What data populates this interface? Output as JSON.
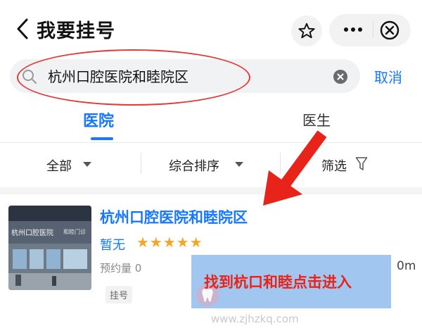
{
  "header": {
    "title": "我要挂号"
  },
  "search": {
    "query": "杭州口腔医院和睦院区",
    "cancel_label": "取消"
  },
  "tabs": [
    {
      "label": "医院",
      "active": true
    },
    {
      "label": "医生",
      "active": false
    }
  ],
  "filters": {
    "all": "全部",
    "sort": "综合排序",
    "screen": "筛选"
  },
  "result": {
    "name": "杭州口腔医院和睦院区",
    "rating_text": "暂无",
    "stars": "★★★★★",
    "appointments": "预约量 0",
    "tag": "挂号",
    "distance_fragment": "0m",
    "thumb_sign": "杭州口腔医院",
    "thumb_sign2": "和睦门诊"
  },
  "annotation": {
    "text": "找到杭口和睦点击进入"
  },
  "watermark": "www.zjhzkq.com",
  "colors": {
    "accent": "#1677ff",
    "star": "#f5a623",
    "annotation_red": "#e53935",
    "annotation_bg": "#9cc3ee"
  }
}
